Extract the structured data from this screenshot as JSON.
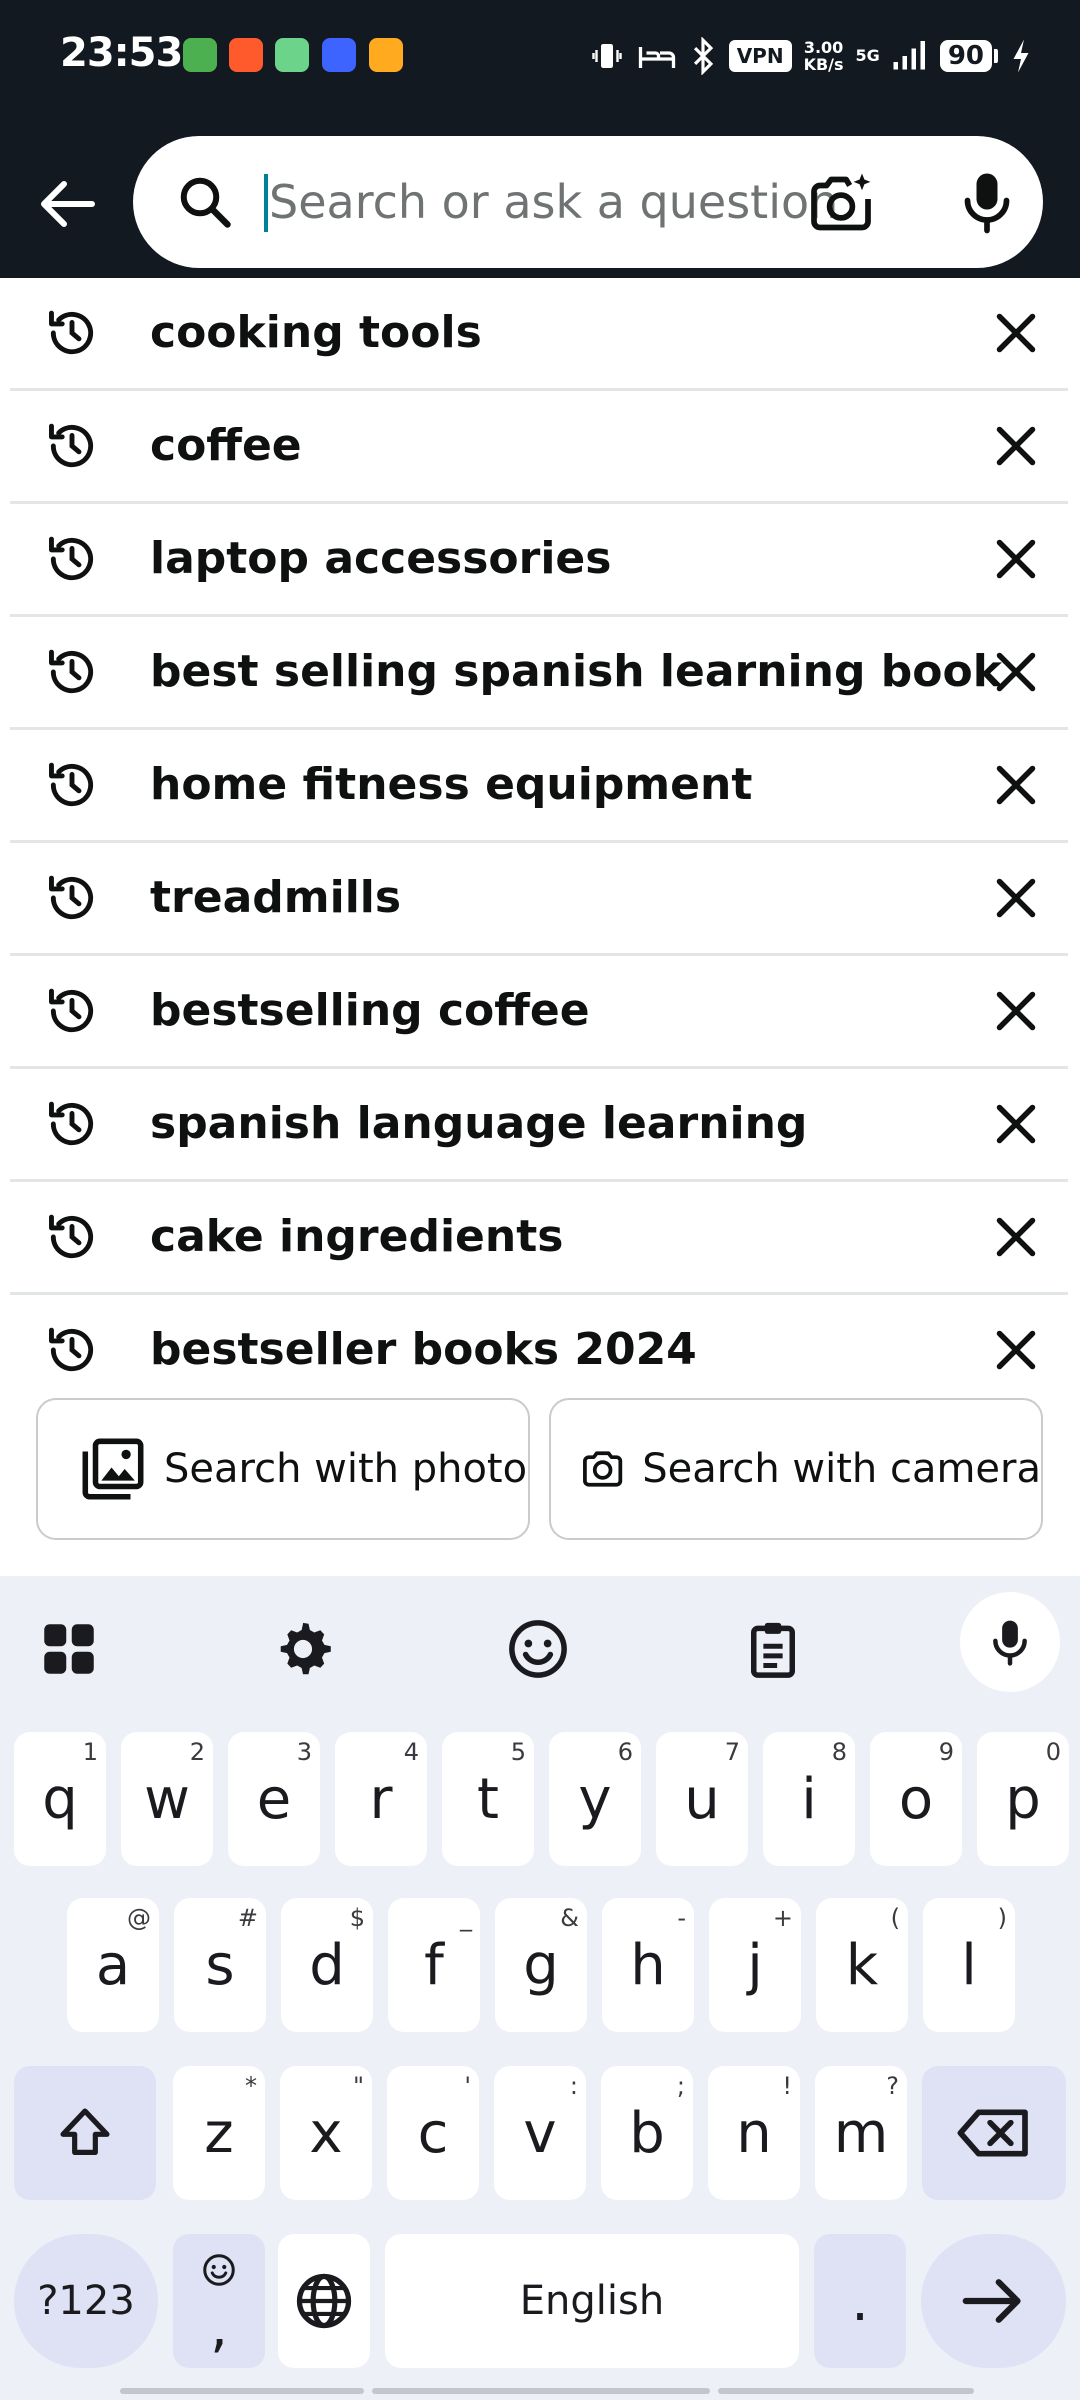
{
  "status_bar": {
    "time": "23:53",
    "vpn": "VPN",
    "net_speed_value": "3.00",
    "net_speed_unit": "KB/s",
    "network": "5G",
    "battery": "90"
  },
  "header": {
    "search": {
      "placeholder": "Search or ask a question",
      "value": ""
    }
  },
  "history": [
    "cooking tools",
    "coffee",
    "laptop accessories",
    "best selling spanish learning book",
    "home fitness equipment",
    "treadmills",
    "bestselling coffee",
    "spanish language learning",
    "cake ingredients",
    "bestseller books 2024"
  ],
  "visual_search": {
    "photo": "Search with photo",
    "camera": "Search with camera"
  },
  "keyboard": {
    "row1": [
      {
        "k": "q",
        "h": "1"
      },
      {
        "k": "w",
        "h": "2"
      },
      {
        "k": "e",
        "h": "3"
      },
      {
        "k": "r",
        "h": "4"
      },
      {
        "k": "t",
        "h": "5"
      },
      {
        "k": "y",
        "h": "6"
      },
      {
        "k": "u",
        "h": "7"
      },
      {
        "k": "i",
        "h": "8"
      },
      {
        "k": "o",
        "h": "9"
      },
      {
        "k": "p",
        "h": "0"
      }
    ],
    "row2": [
      {
        "k": "a",
        "h": "@"
      },
      {
        "k": "s",
        "h": "#"
      },
      {
        "k": "d",
        "h": "$"
      },
      {
        "k": "f",
        "h": "_"
      },
      {
        "k": "g",
        "h": "&"
      },
      {
        "k": "h",
        "h": "-"
      },
      {
        "k": "j",
        "h": "+"
      },
      {
        "k": "k",
        "h": "("
      },
      {
        "k": "l",
        "h": ")"
      }
    ],
    "row3": [
      {
        "k": "z",
        "h": "*"
      },
      {
        "k": "x",
        "h": "\""
      },
      {
        "k": "c",
        "h": "'"
      },
      {
        "k": "v",
        "h": ":"
      },
      {
        "k": "b",
        "h": ";"
      },
      {
        "k": "n",
        "h": "!"
      },
      {
        "k": "m",
        "h": "?"
      }
    ],
    "symbols_key": "?123",
    "comma": ",",
    "space": "English",
    "period": "."
  },
  "colors": {
    "header_bg": "#131921",
    "caret": "#008296",
    "keyboard_bg": "#eef0f7",
    "special_key_bg": "#dfe1f5"
  }
}
